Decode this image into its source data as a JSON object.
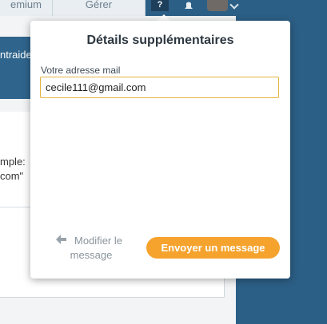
{
  "background": {
    "tab_one_label": "emium",
    "tab_two_label": "Gérer",
    "help_icon_label": "?",
    "banner_text": "ntraide",
    "content_line1": "mple:",
    "content_line2": "com\""
  },
  "popover": {
    "title": "Détails supplémentaires",
    "email_label": "Votre adresse mail",
    "email_value": "cecile111@gmail.com",
    "back_label": "Modifier le message",
    "send_label": "Envoyer un message"
  },
  "colors": {
    "accent": "#f5a32d",
    "header_blue": "#2c5f86",
    "input_border": "#e5b343"
  }
}
